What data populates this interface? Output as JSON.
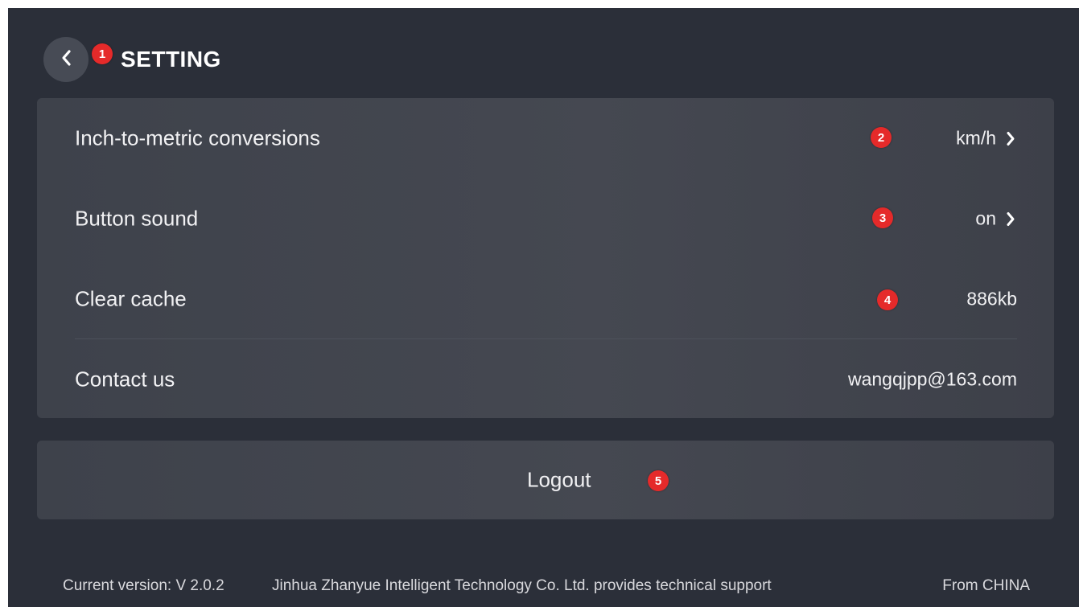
{
  "header": {
    "title": "SETTING",
    "back_icon": "chevron-left-icon",
    "badge": "1"
  },
  "settings": {
    "items": [
      {
        "label": "Inch-to-metric conversions",
        "value": "km/h",
        "badge": "2",
        "has_chevron": true
      },
      {
        "label": "Button sound",
        "value": "on",
        "badge": "3",
        "has_chevron": true
      },
      {
        "label": "Clear cache",
        "value": "886kb",
        "badge": "4",
        "has_chevron": false
      },
      {
        "label": "Contact us",
        "value": "wangqjpp@163.com",
        "badge": "",
        "has_chevron": false
      }
    ]
  },
  "logout": {
    "label": "Logout",
    "badge": "5"
  },
  "footer": {
    "version": "Current version: V 2.0.2",
    "support": "Jinhua Zhanyue Intelligent Technology Co. Ltd. provides technical support",
    "origin": "From CHINA"
  },
  "colors": {
    "background": "#2b2f39",
    "card": "#42454e",
    "badge": "#e52a2a",
    "text": "#f1f1f3"
  }
}
